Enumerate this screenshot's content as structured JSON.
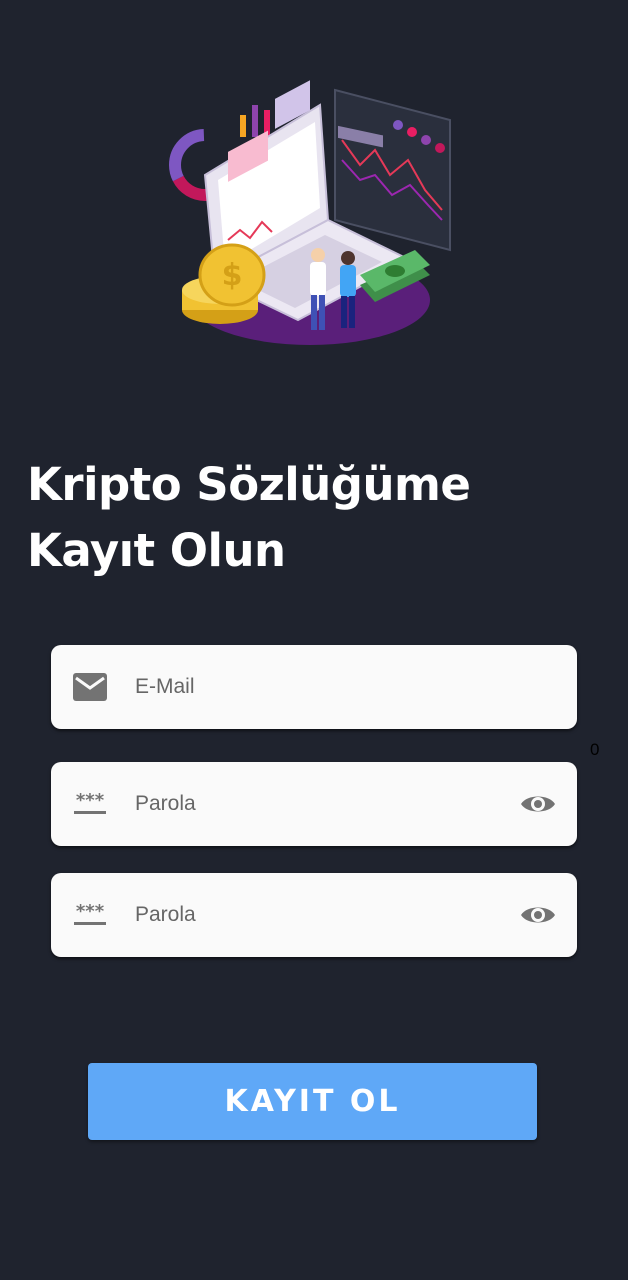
{
  "hero": {
    "illustration": "crypto-laptop-illustration"
  },
  "title": {
    "line1": "Kripto Sözlüğüme",
    "line2": "Kayıt Olun"
  },
  "form": {
    "email": {
      "placeholder": "E-Mail",
      "icon": "email-icon"
    },
    "counter": "0",
    "password": {
      "placeholder": "Parola",
      "icon": "password-icon",
      "toggle_icon": "eye-icon"
    },
    "password_confirm": {
      "placeholder": "Parola",
      "icon": "password-icon",
      "toggle_icon": "eye-icon"
    }
  },
  "register_button": {
    "label": "KAYIT OL"
  },
  "colors": {
    "background": "#1f232e",
    "field_bg": "#fafafa",
    "button": "#5fa8f7",
    "icon": "#737373"
  }
}
